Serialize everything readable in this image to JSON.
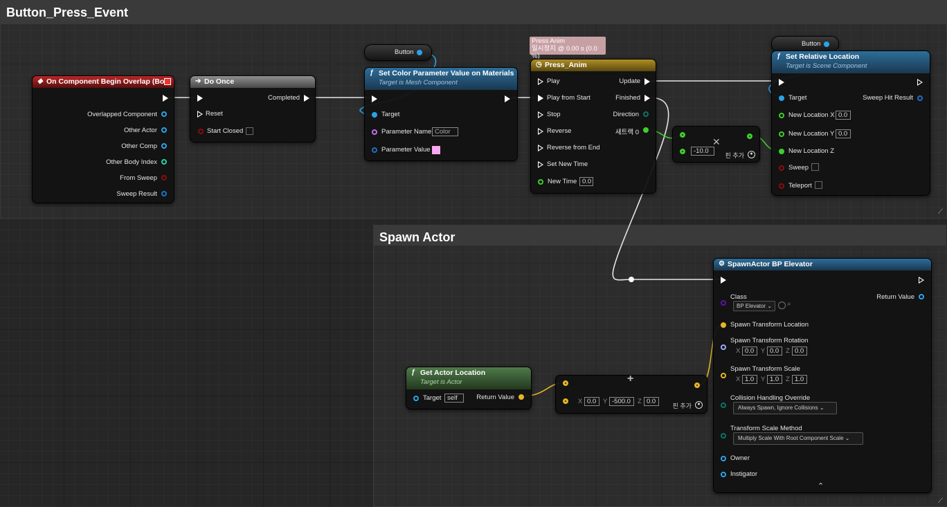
{
  "comments": {
    "button_press_event": "Button_Press_Event",
    "spawn_actor": "Spawn Actor"
  },
  "overlap_node": {
    "title": "On Component Begin Overlap (Box)",
    "pins": [
      "Overlapped Component",
      "Other Actor",
      "Other Comp",
      "Other Body Index",
      "From Sweep",
      "Sweep Result"
    ]
  },
  "do_once": {
    "title": "Do Once",
    "completed": "Completed",
    "reset": "Reset",
    "start_closed": "Start Closed"
  },
  "button_var_1": {
    "label": "Button"
  },
  "button_var_2": {
    "label": "Button"
  },
  "set_color": {
    "title": "Set Color Parameter Value on Materials",
    "subtitle": "Target is Mesh Component",
    "target": "Target",
    "param_name_label": "Parameter Name",
    "param_name_value": "Color",
    "param_value_label": "Parameter Value",
    "param_value_color": "#f7a8f2"
  },
  "timeline": {
    "tooltip_title": "Press Anim",
    "tooltip_sub": "일시정지 @ 0.00 s (0.0 %)",
    "title": "Press_Anim",
    "inputs": [
      "Play",
      "Play from Start",
      "Stop",
      "Reverse",
      "Reverse from End",
      "Set New Time"
    ],
    "new_time_label": "New Time",
    "new_time_value": "0.0",
    "update": "Update",
    "finished": "Finished",
    "direction": "Direction",
    "track": "새트랙 0"
  },
  "multiply_node": {
    "value": "-10.0",
    "add_pin": "핀 추가"
  },
  "set_relative_location": {
    "title": "Set Relative Location",
    "subtitle": "Target is Scene Component",
    "target": "Target",
    "sweep_hit_result": "Sweep Hit Result",
    "new_location_x": "New Location X",
    "new_location_x_value": "0.0",
    "new_location_y": "New Location Y",
    "new_location_y_value": "0.0",
    "new_location_z": "New Location Z",
    "sweep": "Sweep",
    "teleport": "Teleport"
  },
  "spawn_actor": {
    "title": "SpawnActor BP Elevator",
    "class": "Class",
    "class_value": "BP Elevator",
    "return_value": "Return Value",
    "spawn_location": "Spawn Transform Location",
    "spawn_rotation": "Spawn Transform Rotation",
    "rotation_values": [
      "0.0",
      "0.0",
      "0.0"
    ],
    "spawn_scale": "Spawn Transform Scale",
    "scale_values": [
      "1.0",
      "1.0",
      "1.0"
    ],
    "collision": "Collision Handling Override",
    "collision_value": "Always Spawn, Ignore Collisions",
    "scale_method": "Transform Scale Method",
    "scale_method_value": "Multiply Scale With Root Component Scale",
    "owner": "Owner",
    "instigator": "Instigator"
  },
  "get_actor_location": {
    "title": "Get Actor Location",
    "subtitle": "Target is Actor",
    "target": "Target",
    "target_value": "self",
    "return_value": "Return Value"
  },
  "add_vector": {
    "x": "0.0",
    "y": "-500.0",
    "z": "0.0",
    "add_pin": "핀 추가"
  },
  "axis_labels": {
    "x": "X",
    "y": "Y",
    "z": "Z"
  }
}
